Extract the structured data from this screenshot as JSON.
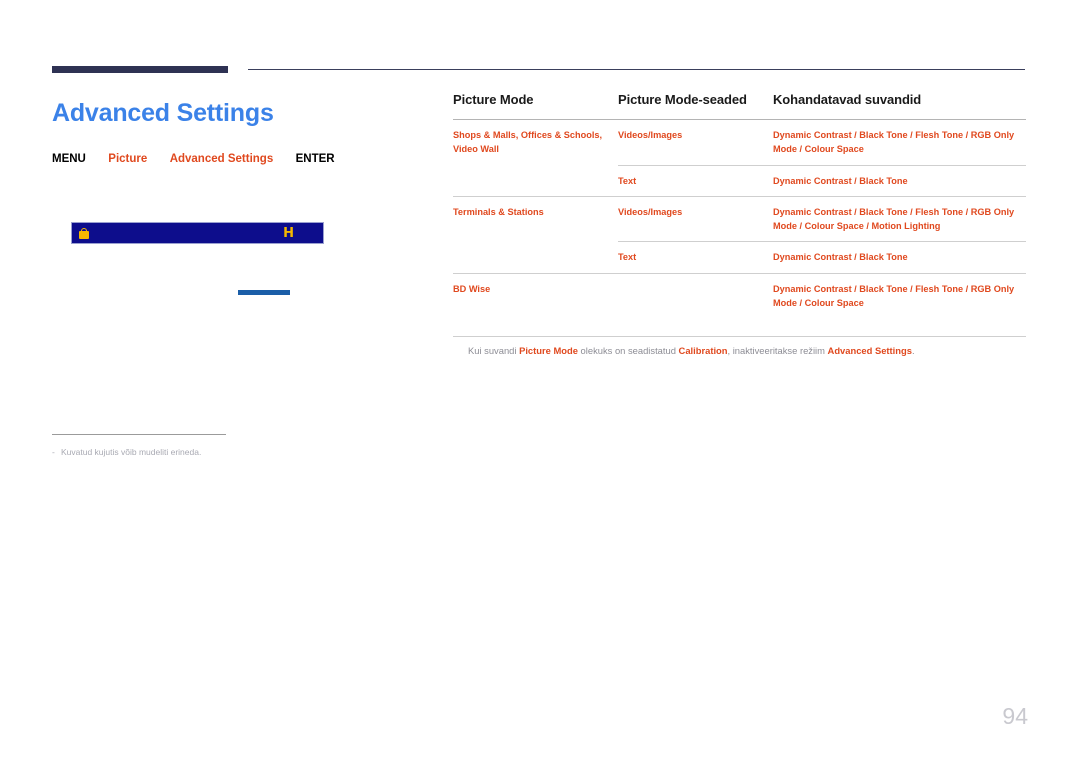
{
  "page": {
    "number": "94",
    "title": "Advanced Settings"
  },
  "breadcrumb": {
    "menu": "MENU",
    "item1": "Picture",
    "item2": "Advanced Settings",
    "enter": "ENTER"
  },
  "osd_image": {
    "left_icon": "lock-icon",
    "right_icon": "H"
  },
  "left_note": {
    "dash": "-",
    "text": "Kuvatud kujutis võib mudeliti erineda."
  },
  "table": {
    "headers": {
      "col1": "Picture Mode",
      "col2": "Picture Mode-seaded",
      "col3": "Kohandatavad suvandid"
    },
    "rows": [
      {
        "mode": "Shops & Malls, Offices & Schools, Video Wall",
        "sub": "Videos/Images",
        "options": "Dynamic Contrast / Black Tone / Flesh Tone / RGB Only Mode / Colour Space"
      },
      {
        "mode": "",
        "sub": "Text",
        "options": "Dynamic Contrast / Black Tone"
      },
      {
        "mode": "Terminals & Stations",
        "sub": "Videos/Images",
        "options": "Dynamic Contrast / Black Tone / Flesh Tone / RGB Only Mode / Colour Space / Motion Lighting"
      },
      {
        "mode": "",
        "sub": "Text",
        "options": "Dynamic Contrast / Black Tone"
      },
      {
        "mode": "BD Wise",
        "sub": "",
        "options": "Dynamic Contrast / Black Tone / Flesh Tone / RGB Only Mode / Colour Space"
      }
    ]
  },
  "footnote": {
    "part1": "Kui suvandi ",
    "bold1": "Picture Mode",
    "part2": " olekuks on seadistatud ",
    "bold2": "Calibration",
    "part3": ", inaktiveeritakse režiim ",
    "bold3": "Advanced Settings",
    "part4": "."
  },
  "colors": {
    "title_blue": "#3b82e8",
    "accent_orange": "#e0491f",
    "rule_navy": "#2e3253",
    "osd_navy": "#0d0d8c",
    "osd_yellow": "#f5b800",
    "underline_blue": "#1b5ea8",
    "muted_grey": "#a9aab3"
  }
}
